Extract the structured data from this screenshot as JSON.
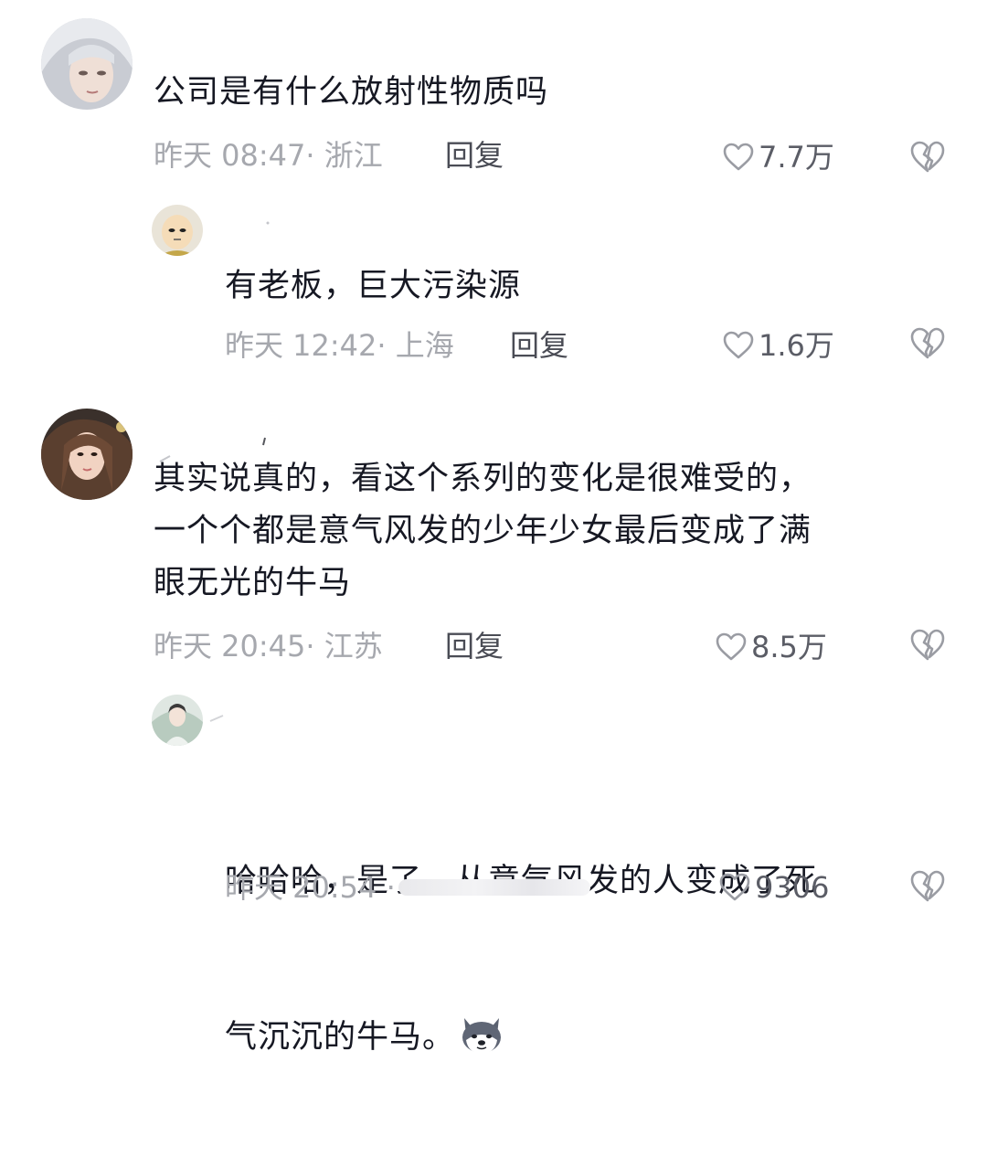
{
  "comments": [
    {
      "text": "公司是有什么放射性物质吗",
      "time": "昨天 08:47",
      "location": "· 浙江",
      "reply_label": "回复",
      "likes": "7.7万"
    },
    {
      "text": "有老板，巨大污染源",
      "time": "昨天 12:42",
      "location": "· 上海",
      "reply_label": "回复",
      "likes": "1.6万"
    },
    {
      "text": "其实说真的，看这个系列的变化是很难受的，\n一个个都是意气风发的少年少女最后变成了满\n眼无光的牛马",
      "time": "昨天 20:45",
      "location": "· 江苏",
      "reply_label": "回复",
      "likes": "8.5万"
    },
    {
      "text_line1": "哈哈哈，是了，从意气风发的人变成了死",
      "text_line2": "气沉沉的牛马。",
      "emoji": "husky-dog-emoji",
      "time": "昨天 20:54",
      "likes": "9306"
    }
  ],
  "icons": {
    "like": "heart-outline-icon",
    "dislike": "broken-heart-icon"
  },
  "colors": {
    "text": "#161823",
    "meta": "#a6a8ae",
    "reply": "#4a4c55",
    "icon": "#9a9ca3"
  }
}
